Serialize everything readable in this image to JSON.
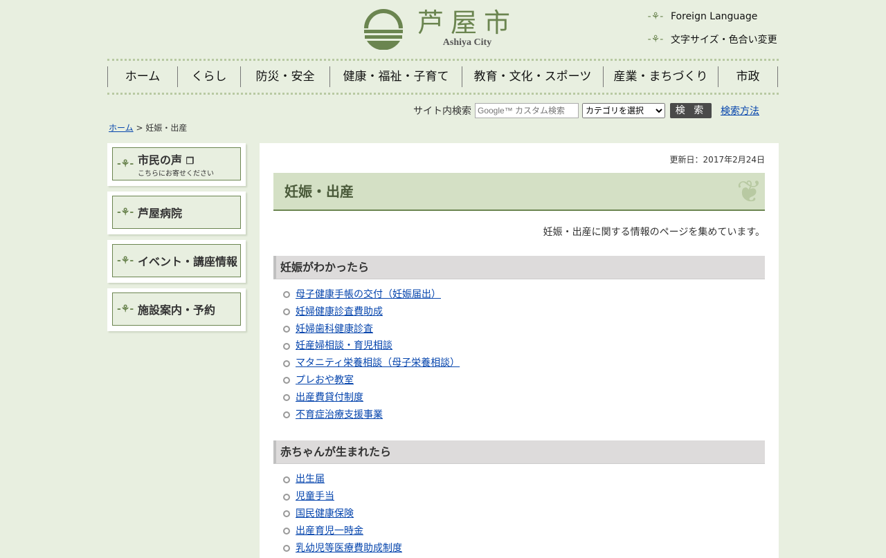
{
  "logo": {
    "name_jp": "芦屋市",
    "name_en": "Ashiya City"
  },
  "util": {
    "foreign": "Foreign Language",
    "font_color": "文字サイズ・色合い変更"
  },
  "nav": [
    "ホーム",
    "くらし",
    "防災・安全",
    "健康・福祉・子育て",
    "教育・文化・スポーツ",
    "産業・まちづくり",
    "市政"
  ],
  "search": {
    "label": "サイト内検索",
    "placeholder": "Google™ カスタム検索",
    "category": "カテゴリを選択",
    "button": "検 索",
    "method": "検索方法"
  },
  "breadcrumb": {
    "home": "ホーム",
    "sep": " > ",
    "current": "妊娠・出産"
  },
  "sidebar": [
    {
      "label": "市民の声",
      "sub": "こちらにお寄せください"
    },
    {
      "label": "芦屋病院"
    },
    {
      "label": "イベント・講座情報"
    },
    {
      "label": "施設案内・予約"
    }
  ],
  "main": {
    "updated": "更新日：2017年2月24日",
    "title": "妊娠・出産",
    "intro": "妊娠・出産に関する情報のページを集めています。",
    "sections": [
      {
        "heading": "妊娠がわかったら",
        "links": [
          "母子健康手帳の交付（妊娠届出）",
          "妊婦健康診査費助成",
          "妊婦歯科健康診査",
          "妊産婦相談・育児相談",
          "マタニティ栄養相談（母子栄養相談）",
          "プレおや教室",
          "出産費貸付制度",
          "不育症治療支援事業"
        ]
      },
      {
        "heading": "赤ちゃんが生まれたら",
        "links": [
          "出生届",
          "児童手当",
          "国民健康保険",
          "出産育児一時金",
          "乳幼児等医療費助成制度"
        ]
      }
    ]
  }
}
